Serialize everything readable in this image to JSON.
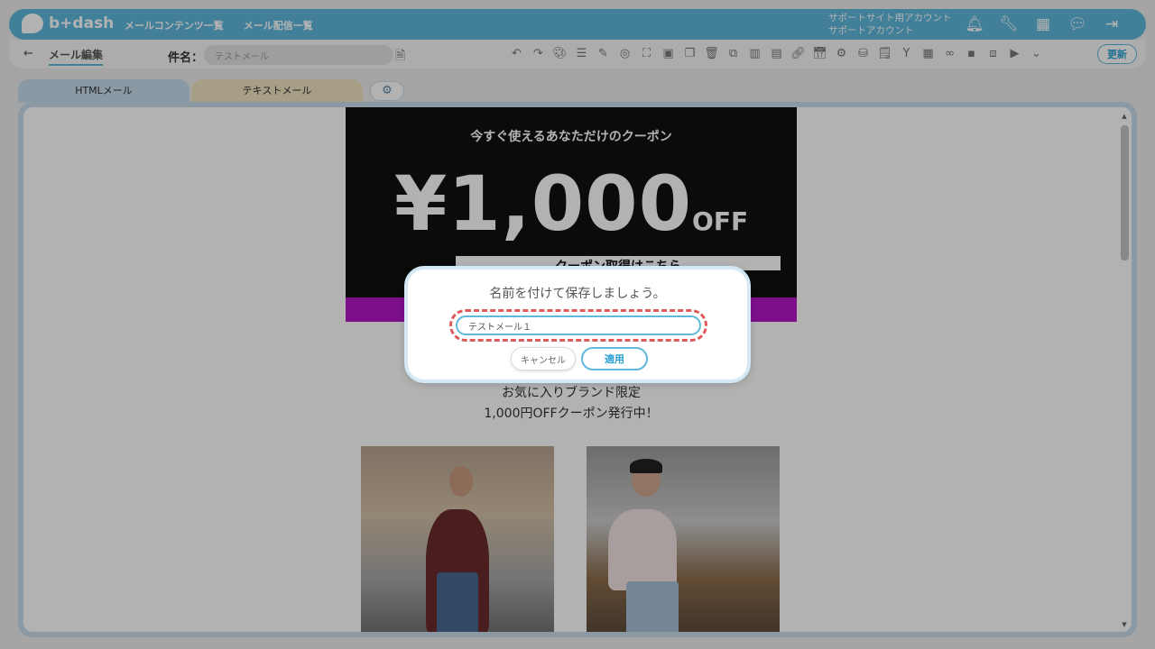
{
  "header": {
    "logo_text": "b+dash",
    "nav": [
      "メールコンテンツ一覧",
      "メール配信一覧"
    ],
    "account_line1": "サポートサイト用アカウント",
    "account_line2": "サポートアカウント",
    "icons": [
      "bell-icon",
      "wrench-icon",
      "grid-icon",
      "chat-icon",
      "logout-icon"
    ]
  },
  "subbar": {
    "back_glyph": "←",
    "breadcrumb": "メール編集",
    "subject_label": "件名：",
    "subject_value": "テストメール",
    "update_label": "更新"
  },
  "tabs": {
    "html": "HTMLメール",
    "text": "テキストメール"
  },
  "email": {
    "coupon_heading": "今すぐ使えるあなただけのクーポン",
    "coupon_amount": "¥1,000",
    "coupon_off": "OFF",
    "coupon_button": "クーポン取得はこちら",
    "promo_line1": "お気に入りブランド限定",
    "promo_line2": "1,000円OFFクーポン発行中！"
  },
  "modal": {
    "title": "名前を付けて保存しましょう。",
    "input_value": "テストメール１",
    "cancel_label": "キャンセル",
    "apply_label": "適用"
  },
  "colors": {
    "brand": "#5fb8db",
    "highlight_dashed": "#e05a5a",
    "coupon_band": "#b416c7"
  }
}
